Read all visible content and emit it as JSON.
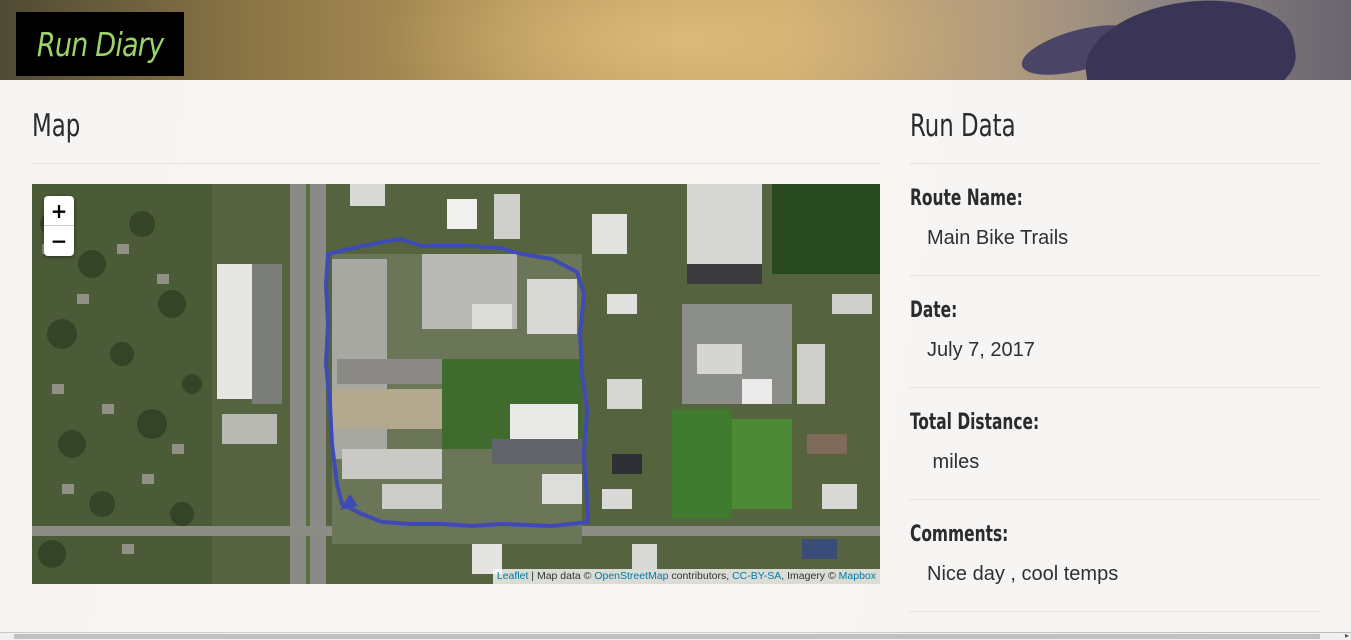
{
  "header": {
    "logo": "Run Diary"
  },
  "map_section": {
    "title": "Map",
    "zoom_in": "+",
    "zoom_out": "−",
    "attribution": {
      "leaflet": "Leaflet",
      "map_data": " | Map data © ",
      "osm": "OpenStreetMap",
      "contributors": " contributors, ",
      "license": "CC-BY-SA",
      "imagery": ", Imagery © ",
      "mapbox": "Mapbox"
    },
    "route_color": "#3f4bb5"
  },
  "run_data": {
    "title": "Run Data",
    "fields": [
      {
        "label": "Route Name:",
        "value": "Main Bike Trails"
      },
      {
        "label": "Date:",
        "value": "July 7, 2017"
      },
      {
        "label": "Total Distance:",
        "value": " miles"
      },
      {
        "label": "Comments:",
        "value": "Nice day , cool temps"
      }
    ]
  }
}
